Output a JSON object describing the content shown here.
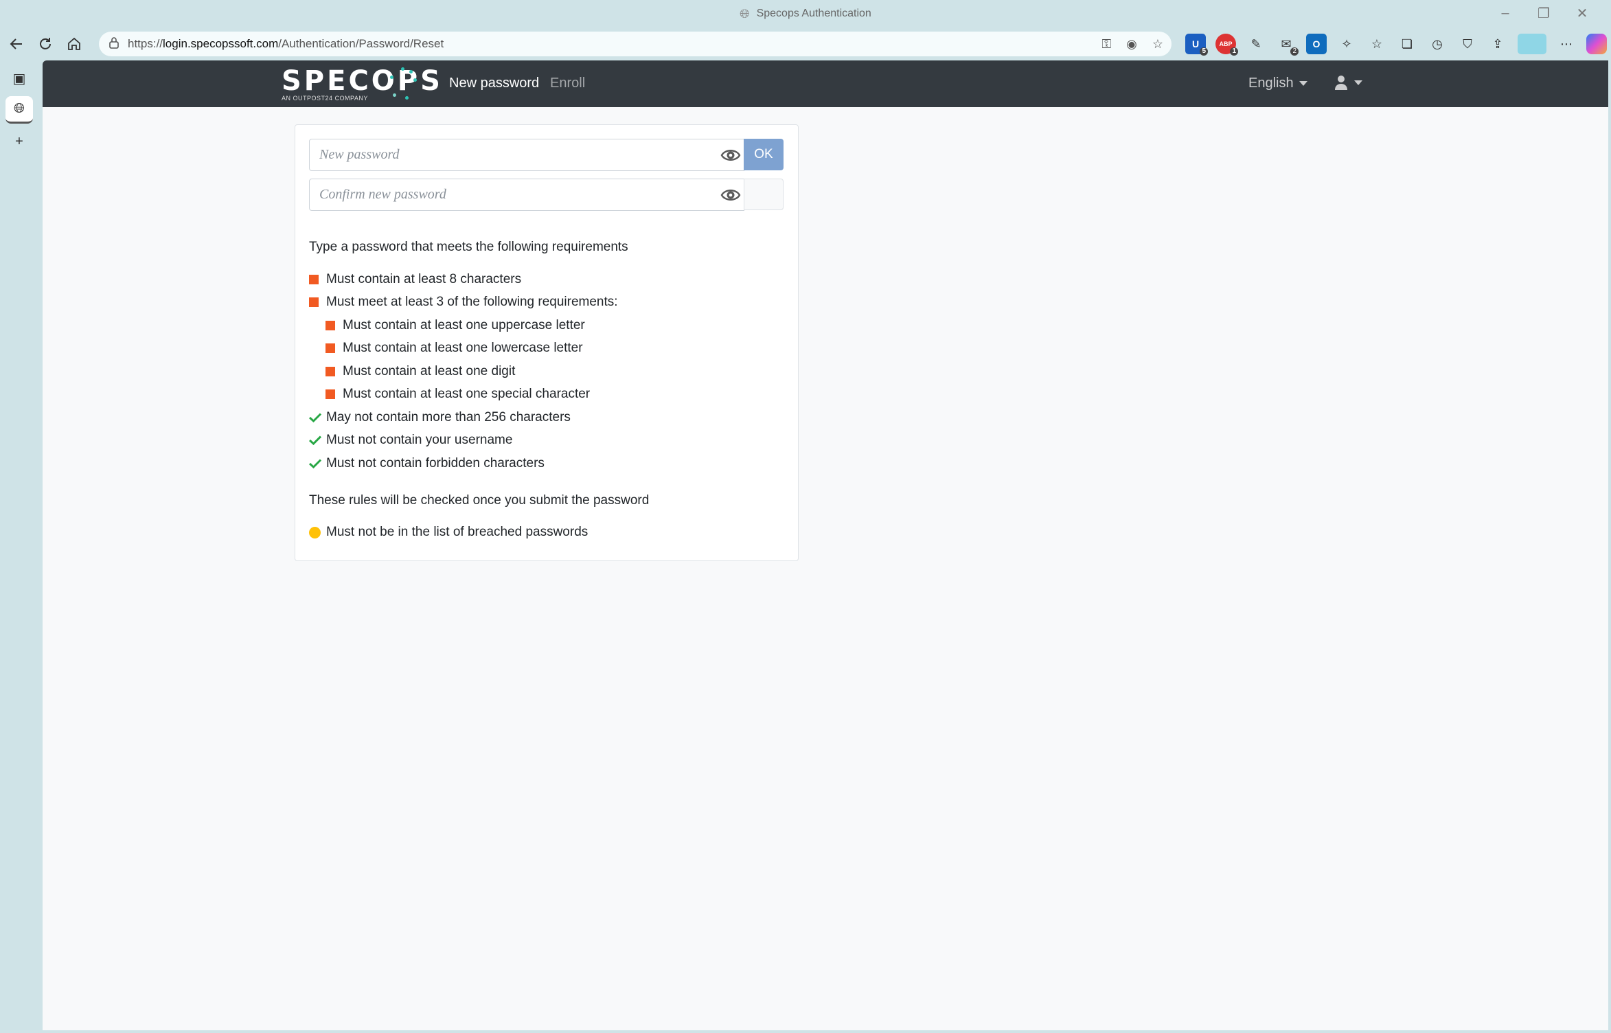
{
  "window": {
    "title": "Specops Authentication",
    "controls": [
      "minimize",
      "restore",
      "close"
    ]
  },
  "browser": {
    "url_prefix": "https://",
    "url_host": "login.specopssoft.com",
    "url_path": "/Authentication/Password/Reset",
    "extensions": [
      {
        "name": "bitwarden",
        "badge": "5"
      },
      {
        "name": "adblock",
        "label": "ABP",
        "badge": "1"
      },
      {
        "name": "extension-3"
      },
      {
        "name": "extension-4",
        "badge": "2"
      },
      {
        "name": "outlook",
        "label": "O"
      },
      {
        "name": "extensions-puzzle"
      },
      {
        "name": "favorites"
      },
      {
        "name": "collections"
      },
      {
        "name": "history"
      },
      {
        "name": "browser-essentials"
      },
      {
        "name": "share"
      },
      {
        "name": "profile"
      },
      {
        "name": "more"
      },
      {
        "name": "copilot"
      }
    ]
  },
  "site": {
    "brand_logo": "SPECOPS",
    "brand_tagline": "AN OUTPOST24 COMPANY",
    "nav": {
      "new_password": "New password",
      "enroll": "Enroll"
    },
    "language": "English"
  },
  "form": {
    "new_password_placeholder": "New password",
    "confirm_password_placeholder": "Confirm new password",
    "new_password_value": "",
    "confirm_password_value": "",
    "ok_label": "OK"
  },
  "requirements": {
    "intro": "Type a password that meets the following requirements",
    "items": [
      {
        "text": "Must contain at least 8 characters",
        "status": "unmet",
        "level": 0
      },
      {
        "text": "Must meet at least 3 of the following requirements:",
        "status": "unmet",
        "level": 0
      },
      {
        "text": "Must contain at least one uppercase letter",
        "status": "unmet",
        "level": 1
      },
      {
        "text": "Must contain at least one lowercase letter",
        "status": "unmet",
        "level": 1
      },
      {
        "text": "Must contain at least one digit",
        "status": "unmet",
        "level": 1
      },
      {
        "text": "Must contain at least one special character",
        "status": "unmet",
        "level": 1
      },
      {
        "text": "May not contain more than 256 characters",
        "status": "met",
        "level": 0
      },
      {
        "text": "Must not contain your username",
        "status": "met",
        "level": 0
      },
      {
        "text": "Must not contain forbidden characters",
        "status": "met",
        "level": 0
      }
    ],
    "submit_note": "These rules will be checked once you submit the password",
    "breach_rule": {
      "text": "Must not be in the list of breached passwords",
      "status": "pending"
    }
  },
  "colors": {
    "unmet": "#f15a22",
    "met": "#28a745",
    "pending": "#ffc107",
    "navbar": "#343a40",
    "ok_button": "#7ea2d1"
  }
}
